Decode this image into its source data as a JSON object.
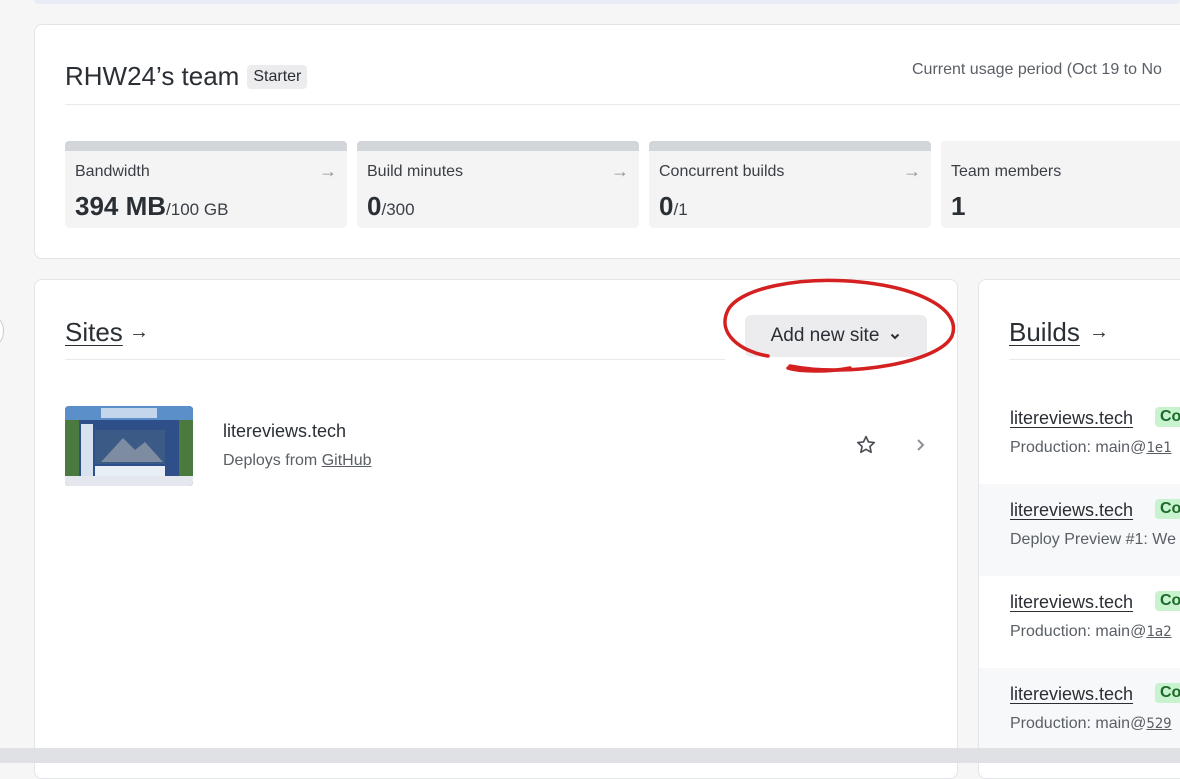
{
  "team": {
    "name": "RHW24’s team",
    "plan_badge": "Starter",
    "usage_period": "Current usage period (Oct 19 to No"
  },
  "stats": [
    {
      "label": "Bandwidth",
      "value": "394 MB",
      "limit": "/100 GB",
      "arrow": "→"
    },
    {
      "label": "Build minutes",
      "value": "0",
      "limit": "/300",
      "arrow": "→"
    },
    {
      "label": "Concurrent builds",
      "value": "0",
      "limit": "/1",
      "arrow": "→"
    },
    {
      "label": "Team members",
      "value": "1",
      "limit": "",
      "arrow": ""
    }
  ],
  "sites": {
    "title": "Sites",
    "arrow": "→",
    "add_button": "Add new site",
    "items": [
      {
        "name": "litereviews.tech",
        "deploys_prefix": "Deploys from",
        "deploys_link": "GitHub"
      }
    ]
  },
  "builds": {
    "title": "Builds",
    "arrow": "→",
    "items": [
      {
        "name": "litereviews.tech",
        "badge": "Co",
        "desc": "Production: main@",
        "ref": "1e1"
      },
      {
        "name": "litereviews.tech",
        "badge": "Co",
        "desc": "Deploy Preview #1: We",
        "ref": ""
      },
      {
        "name": "litereviews.tech",
        "badge": "Co",
        "desc": "Production: main@",
        "ref": "1a2"
      },
      {
        "name": "litereviews.tech",
        "badge": "Co",
        "desc": "Production: main@",
        "ref": "529"
      }
    ]
  },
  "icons": {
    "arrow": "arrow-right-icon",
    "star": "star-icon",
    "chevron": "chevron-right-icon",
    "dropdown": "chevron-down-icon"
  },
  "colors": {
    "annotation": "#d42020",
    "badge_bg": "#c9f2cf",
    "badge_text": "#1c6b2a"
  }
}
